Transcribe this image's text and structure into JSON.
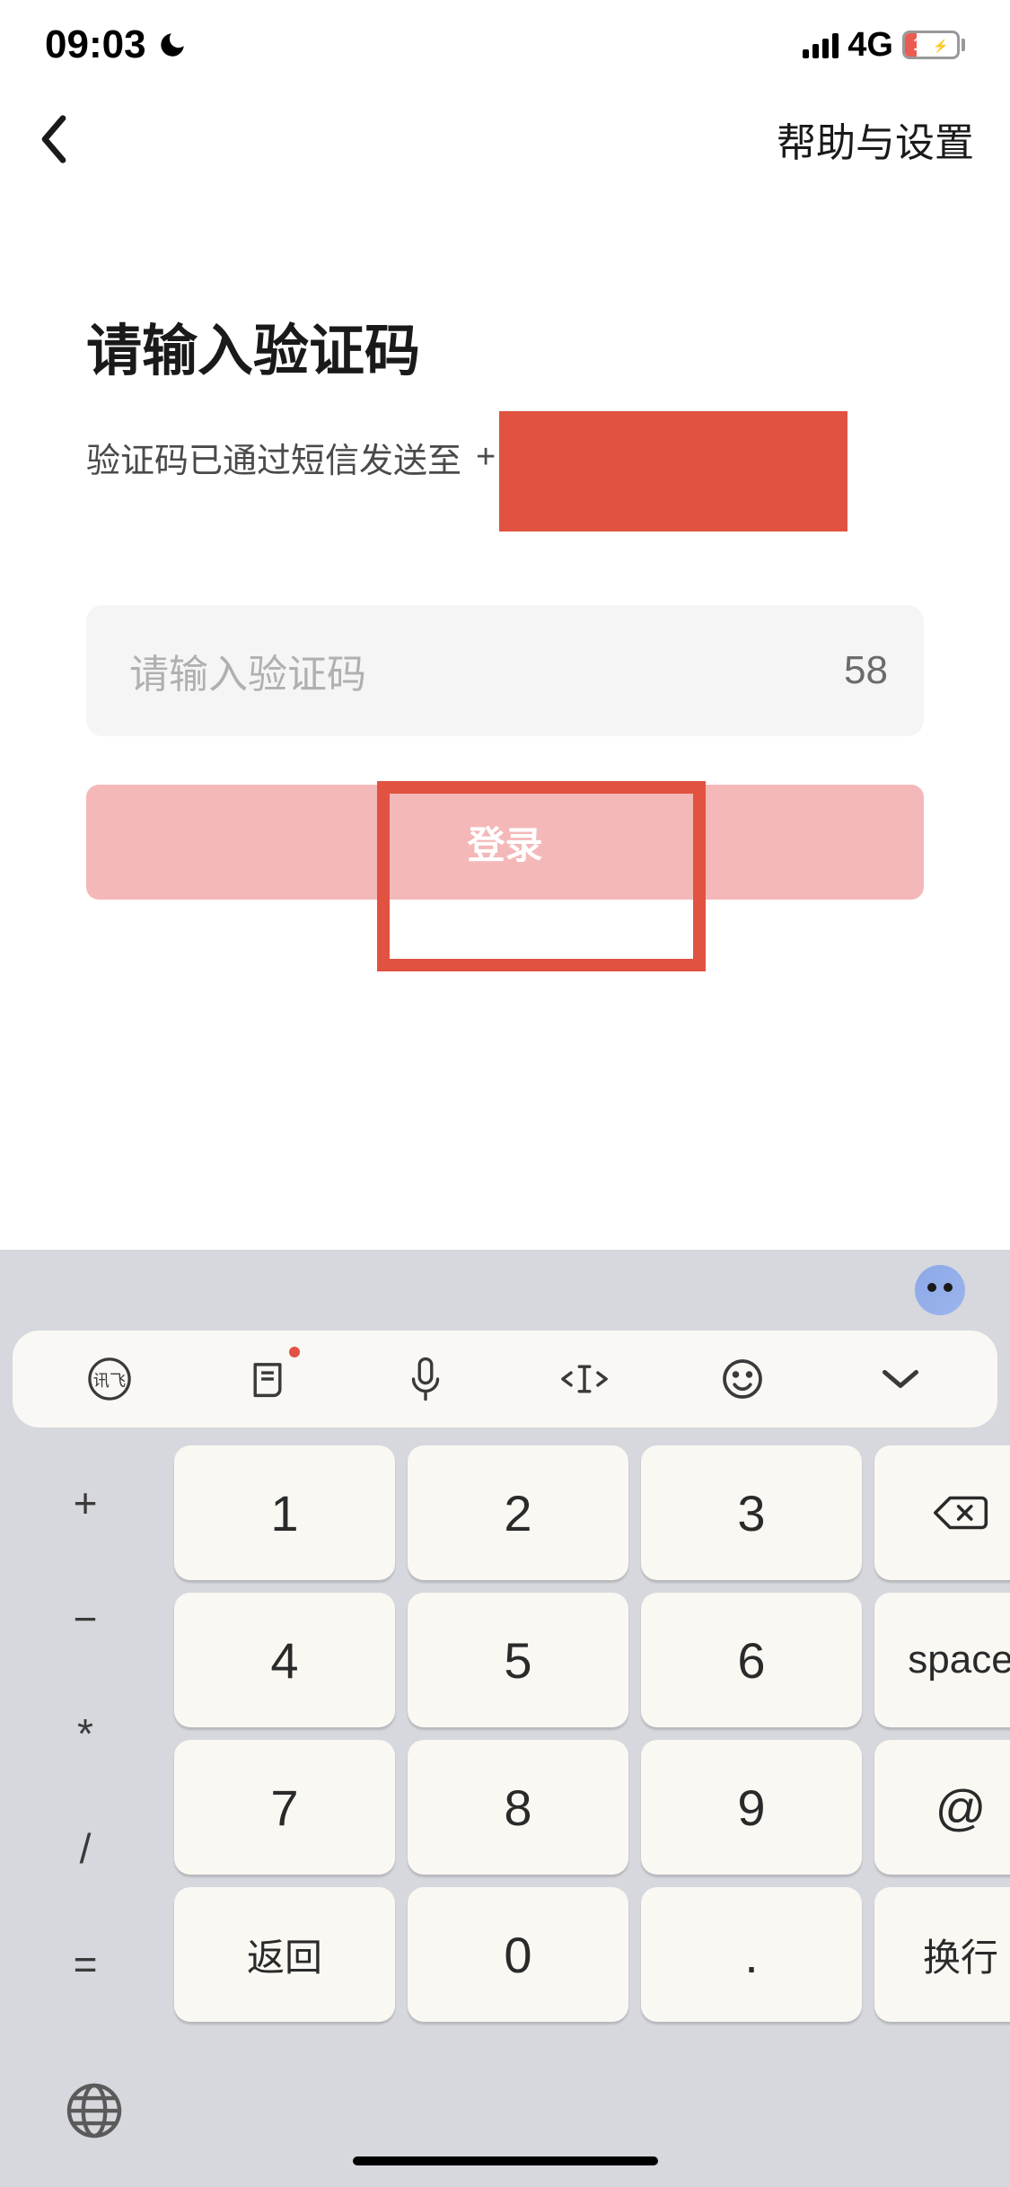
{
  "status": {
    "time": "09:03",
    "network": "4G",
    "battery_pct": "19"
  },
  "nav": {
    "help_settings": "帮助与设置"
  },
  "page": {
    "title": "请输入验证码",
    "subtitle_prefix": "验证码已通过短信发送至",
    "subtitle_plus": "+"
  },
  "input": {
    "placeholder": "请输入验证码",
    "countdown": "58"
  },
  "login_label": "登录",
  "keypad": {
    "side": [
      "+",
      "−",
      "*",
      "/",
      "="
    ],
    "nums": [
      "1",
      "2",
      "3",
      "4",
      "5",
      "6",
      "7",
      "8",
      "9",
      "0"
    ],
    "back_label": "返回",
    "dot": ".",
    "space": "space",
    "at": "@",
    "newline": "换行"
  }
}
